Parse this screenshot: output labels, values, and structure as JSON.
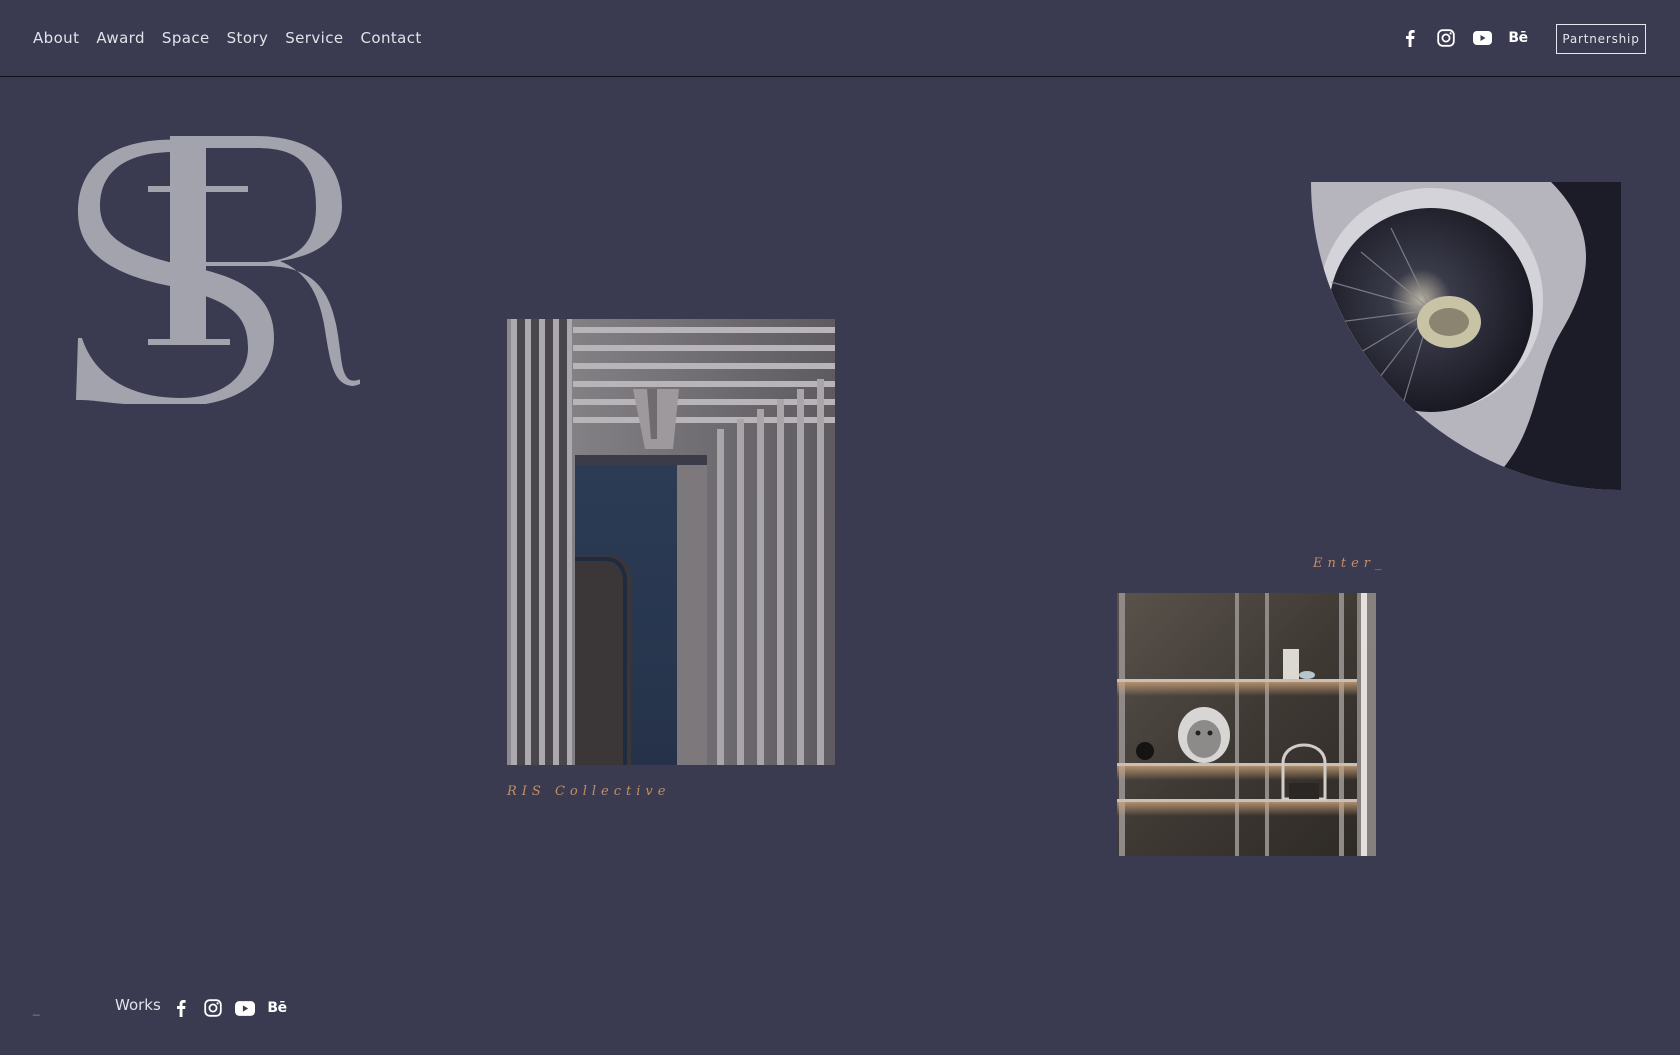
{
  "nav": {
    "items": [
      {
        "label": "About"
      },
      {
        "label": "Award"
      },
      {
        "label": "Space"
      },
      {
        "label": "Story"
      },
      {
        "label": "Service"
      },
      {
        "label": "Contact"
      }
    ]
  },
  "header": {
    "social_icons": [
      "facebook-icon",
      "instagram-icon",
      "youtube-icon",
      "behance-icon"
    ],
    "behance_text": "Bē",
    "partnership_label": "Partnership"
  },
  "logo": {
    "monogram": "SR"
  },
  "gallery": {
    "facade_caption": "RIS Collective",
    "enter_caption": "Enter_"
  },
  "footer": {
    "dash": "_",
    "works_label": "Works",
    "social_icons": [
      "facebook-icon",
      "instagram-icon",
      "youtube-icon",
      "behance-icon"
    ],
    "behance_text": "Bē"
  },
  "colors": {
    "background": "#3a3a50",
    "logo": "#a3a3ad",
    "caption": "#c38f67",
    "text": "#e2e2ea"
  }
}
